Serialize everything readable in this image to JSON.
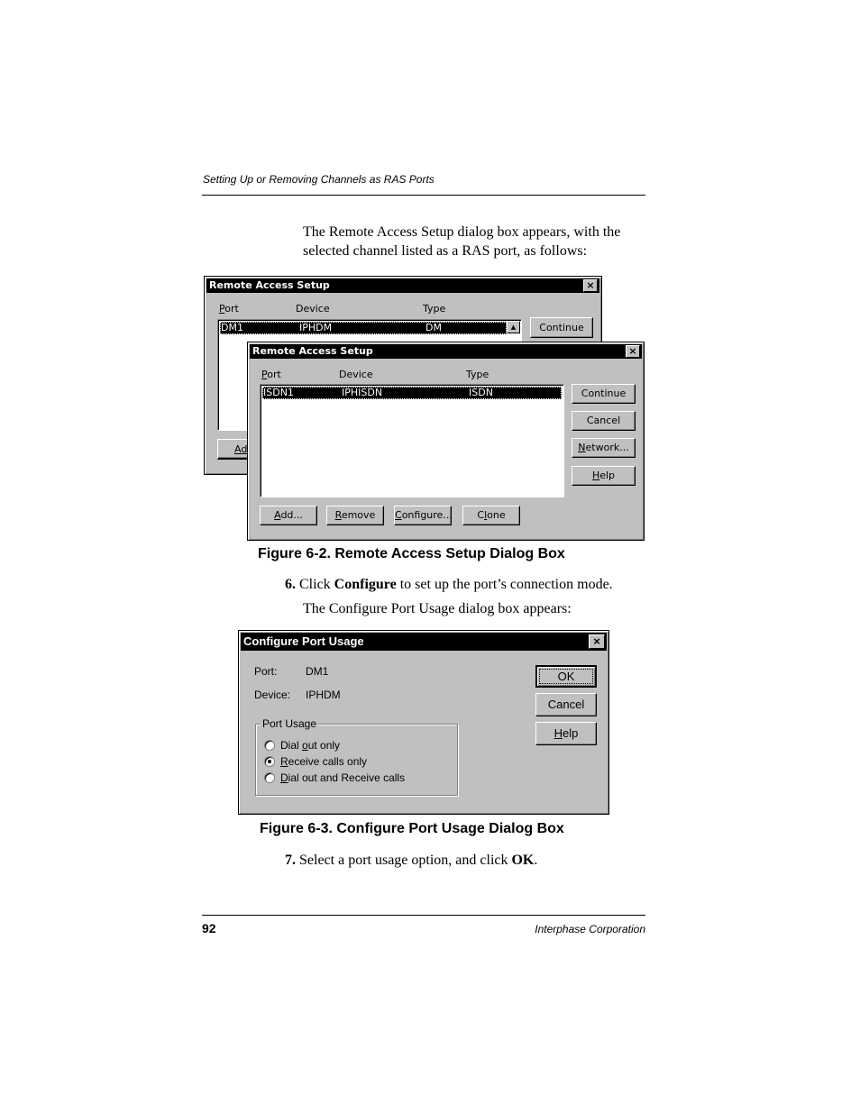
{
  "page": {
    "running_header": "Setting Up or Removing Channels as RAS Ports",
    "intro_line1": "The Remote Access Setup dialog box appears, with the",
    "intro_line2": "selected channel listed as a RAS port, as follows:",
    "figure1_caption": "Figure 6-2.  Remote Access Setup Dialog Box",
    "step6_number": "6.",
    "step6_pre": "Click ",
    "step6_bold": "Configure",
    "step6_post": " to set up the port’s connection mode.",
    "step6_followup": "The Configure Port Usage dialog box appears:",
    "figure2_caption": "Figure 6-3.  Configure Port Usage Dialog Box",
    "step7_number": "7.",
    "step7_pre": "Select a port usage option, and click ",
    "step7_bold": "OK",
    "step7_post": ".",
    "page_number": "92",
    "footer_company": "Interphase Corporation"
  },
  "dialog_back": {
    "title": "Remote Access Setup",
    "close_icon": "×",
    "columns": [
      "Port",
      "Device",
      "Type"
    ],
    "selected_row": {
      "port": "DM1",
      "device": "IPHDM",
      "type": "DM"
    },
    "continue_label": "Continue",
    "add_label_partial": "Ad",
    "scroll_up_icon": "▲"
  },
  "dialog_front": {
    "title": "Remote Access Setup",
    "close_icon": "×",
    "columns": [
      "Port",
      "Device",
      "Type"
    ],
    "selected_row": {
      "port": "ISDN1",
      "device": "IPHISDN",
      "type": "ISDN"
    },
    "side_buttons": [
      "Continue",
      "Cancel",
      "Network...",
      "Help"
    ],
    "bottom_buttons": [
      "Add...",
      "Remove",
      "Configure...",
      "Clone"
    ]
  },
  "configure_dialog": {
    "title": "Configure Port Usage",
    "close_icon": "×",
    "port_label": "Port:",
    "port_value": "DM1",
    "device_label": "Device:",
    "device_value": "IPHDM",
    "group_label": "Port Usage",
    "options": [
      {
        "label": "Dial out only",
        "selected": false
      },
      {
        "label": "Receive calls only",
        "selected": true
      },
      {
        "label": "Dial out and Receive calls",
        "selected": false
      }
    ],
    "ok_label": "OK",
    "cancel_label": "Cancel",
    "help_label": "Help"
  }
}
